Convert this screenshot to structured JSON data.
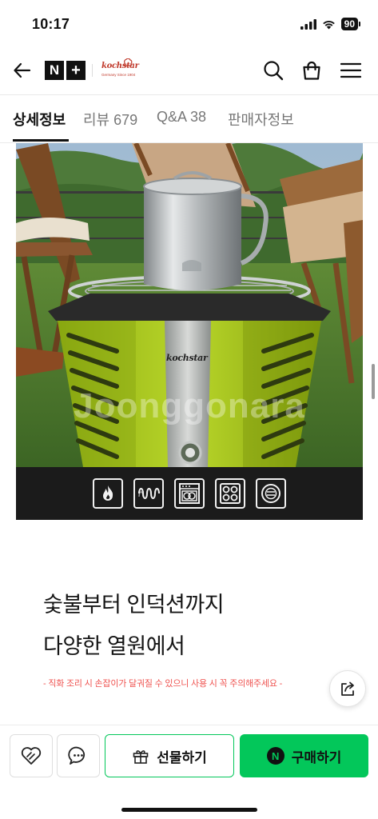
{
  "status_bar": {
    "time": "10:17",
    "battery": "90"
  },
  "header": {
    "store_badge": [
      "N",
      "+"
    ],
    "brand_logo_text": "kochstar",
    "brand_logo_sub": "Germany Since 1904"
  },
  "tabs": [
    {
      "label": "상세정보",
      "active": true
    },
    {
      "label": "리뷰 679",
      "active": false
    },
    {
      "label": "Q&A 38",
      "active": false
    },
    {
      "label": "판매자정보",
      "active": false
    }
  ],
  "product_image": {
    "watermark": "Joonggonara",
    "stove_brand": "kochstar",
    "features": [
      "fire-icon",
      "coil-heater-icon",
      "oven-icon",
      "gas-burner-icon",
      "induction-icon"
    ]
  },
  "content": {
    "headline_line1": "숯불부터 인덕션까지",
    "headline_line2": "다양한 열원에서",
    "caution": "- 직화 조리 시 손잡이가 달궈질 수 있으니 사용 시 꼭 주의해주세요 -"
  },
  "bottom_bar": {
    "gift_label": "선물하기",
    "buy_label": "구매하기",
    "npay_mark": "N"
  },
  "colors": {
    "accent_green": "#03c75a",
    "caution_red": "#ef5350",
    "stove_lime": "#aecb22"
  }
}
